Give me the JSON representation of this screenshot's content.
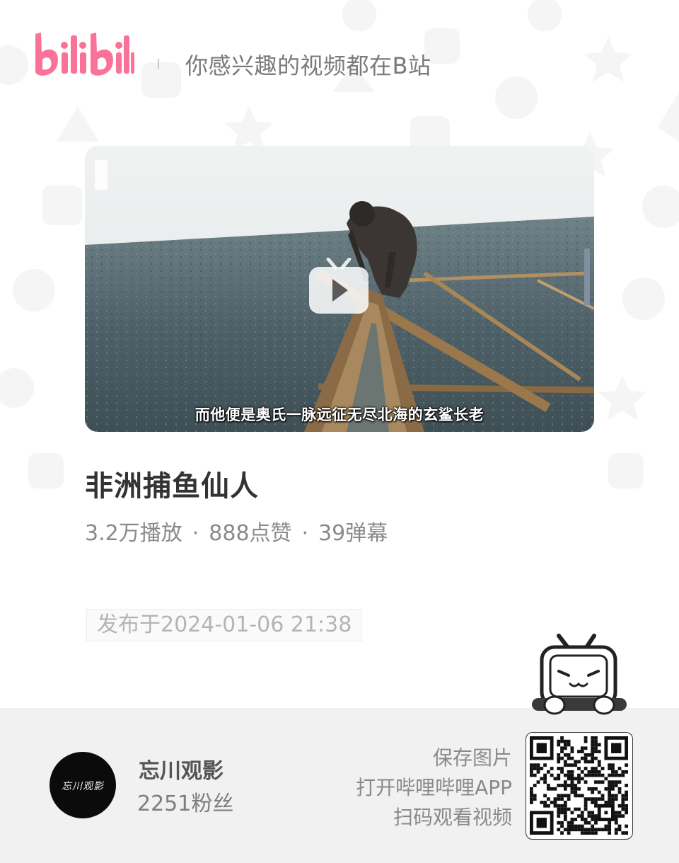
{
  "header": {
    "logo_text": "bilibili",
    "tagline": "你感兴趣的视频都在B站"
  },
  "video": {
    "subtitle": "而他便是奥氏一脉远征无尽北海的玄鲨长老"
  },
  "info": {
    "title": "非洲捕鱼仙人",
    "plays": "3.2万播放",
    "likes": "888点赞",
    "danmaku": "39弹幕",
    "separator": "·",
    "publish_date": "发布于2024-01-06 21:38"
  },
  "uploader": {
    "avatar_text": "忘川观影",
    "name": "忘川观影",
    "fans": "2251粉丝"
  },
  "promo": {
    "line1": "保存图片",
    "line2": "打开哔哩哔哩APP",
    "line3": "扫码观看视频"
  },
  "colors": {
    "brand_pink": "#fb7299",
    "footer_bg": "#f1f1f1"
  },
  "icons": [
    "tv-play-icon",
    "bilibili-tv-mascot-icon",
    "qr-code"
  ]
}
